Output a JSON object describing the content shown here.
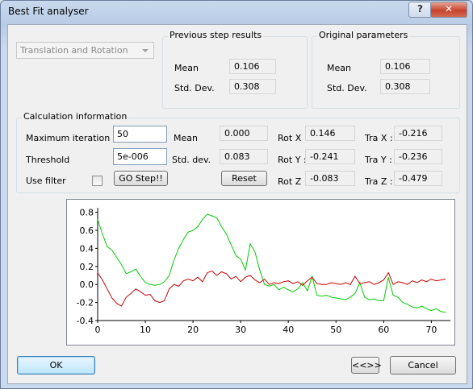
{
  "window": {
    "title": "Best Fit analyser",
    "help_label": "?",
    "close_label": "✕"
  },
  "mode": {
    "selected": "Translation and Rotation"
  },
  "previous": {
    "label": "Previous step results",
    "mean_label": "Mean",
    "mean": "0.106",
    "std_label": "Std. Dev.",
    "std": "0.308"
  },
  "original": {
    "label": "Original parameters",
    "mean_label": "Mean",
    "mean": "0.106",
    "std_label": "Std. Dev.",
    "std": "0.308"
  },
  "calc": {
    "label": "Calculation information",
    "max_iter_label": "Maximum iteration",
    "max_iter": "50",
    "threshold_label": "Threshold",
    "threshold": "5e-006",
    "use_filter_label": "Use filter",
    "go_label": "GO Step!!",
    "reset_label": "Reset",
    "mean_label": "Mean",
    "mean": "0.000",
    "std_label": "Std. dev.",
    "std": "0.083",
    "rotx_label": "Rot X :",
    "rotx": "0.146",
    "roty_label": "Rot Y :",
    "roty": "-0.241",
    "rotz_label": "Rot Z :",
    "rotz": "-0.083",
    "trax_label": "Tra X :",
    "trax": "-0.216",
    "tray_label": "Tra Y :",
    "tray": "-0.236",
    "traz_label": "Tra Z :",
    "traz": "-0.479"
  },
  "buttons": {
    "ok": "OK",
    "swap": "<<>>",
    "cancel": "Cancel"
  },
  "colors": {
    "green_series": "#00cc00",
    "red_series": "#cc0000"
  },
  "chart_data": {
    "type": "line",
    "xlim": [
      0,
      74
    ],
    "ylim": [
      -0.4,
      0.85
    ],
    "xticks": [
      "0",
      "10",
      "20",
      "30",
      "40",
      "50",
      "60",
      "70"
    ],
    "yticks": [
      "0.8",
      "0.6",
      "0.4",
      "0.2",
      "0.0",
      "-0.2",
      "-0.4"
    ],
    "grid": false,
    "series": [
      {
        "color": "#00cc00",
        "x": [
          0,
          1,
          2,
          3,
          4,
          5,
          6,
          7,
          8,
          9,
          10,
          11,
          12,
          13,
          14,
          15,
          16,
          17,
          18,
          19,
          20,
          21,
          22,
          23,
          24,
          25,
          26,
          27,
          28,
          29,
          30,
          31,
          32,
          33,
          34,
          35,
          36,
          37,
          38,
          39,
          40,
          41,
          42,
          43,
          44,
          45,
          46,
          47,
          48,
          49,
          50,
          51,
          52,
          53,
          54,
          55,
          56,
          57,
          58,
          59,
          60,
          61,
          62,
          63,
          64,
          65,
          66,
          67,
          68,
          69,
          70,
          71,
          72,
          73
        ],
        "y": [
          0.72,
          0.56,
          0.42,
          0.38,
          0.3,
          0.22,
          0.12,
          0.14,
          0.17,
          0.09,
          0.02,
          0.0,
          -0.01,
          0.0,
          0.03,
          0.1,
          0.27,
          0.4,
          0.5,
          0.58,
          0.6,
          0.64,
          0.72,
          0.78,
          0.76,
          0.74,
          0.64,
          0.56,
          0.44,
          0.32,
          0.28,
          0.16,
          0.45,
          0.36,
          0.16,
          0.0,
          -0.02,
          0.0,
          -0.06,
          -0.03,
          -0.06,
          -0.08,
          -0.05,
          0.02,
          -0.07,
          0.09,
          -0.12,
          -0.13,
          -0.12,
          -0.14,
          -0.15,
          -0.16,
          -0.17,
          -0.14,
          -0.1,
          0.02,
          -0.14,
          -0.17,
          -0.16,
          -0.18,
          -0.18,
          0.08,
          -0.12,
          -0.14,
          -0.2,
          -0.22,
          -0.25,
          -0.26,
          -0.24,
          -0.27,
          -0.29,
          -0.27,
          -0.3,
          -0.31
        ]
      },
      {
        "color": "#cc0000",
        "x": [
          0,
          1,
          2,
          3,
          4,
          5,
          6,
          7,
          8,
          9,
          10,
          11,
          12,
          13,
          14,
          15,
          16,
          17,
          18,
          19,
          20,
          21,
          22,
          23,
          24,
          25,
          26,
          27,
          28,
          29,
          30,
          31,
          32,
          33,
          34,
          35,
          36,
          37,
          38,
          39,
          40,
          41,
          42,
          43,
          44,
          45,
          46,
          47,
          48,
          49,
          50,
          51,
          52,
          53,
          54,
          55,
          56,
          57,
          58,
          59,
          60,
          61,
          62,
          63,
          64,
          65,
          66,
          67,
          68,
          69,
          70,
          71,
          72,
          73
        ],
        "y": [
          0.13,
          0.05,
          -0.05,
          -0.15,
          -0.21,
          -0.24,
          -0.14,
          -0.1,
          -0.05,
          -0.08,
          -0.12,
          -0.11,
          -0.18,
          -0.2,
          -0.18,
          -0.05,
          0.0,
          -0.02,
          0.04,
          0.06,
          0.04,
          0.08,
          0.03,
          0.13,
          0.15,
          0.1,
          0.14,
          0.12,
          0.06,
          0.09,
          0.03,
          0.08,
          0.1,
          0.05,
          0.02,
          0.06,
          0.0,
          0.02,
          0.01,
          0.03,
          0.04,
          0.01,
          0.03,
          -0.01,
          0.04,
          0.08,
          0.01,
          0.0,
          0.0,
          0.02,
          0.01,
          0.0,
          0.02,
          0.0,
          0.09,
          0.01,
          0.02,
          0.03,
          0.0,
          0.02,
          0.05,
          0.13,
          0.0,
          0.03,
          0.02,
          0.0,
          0.04,
          0.02,
          0.05,
          0.03,
          0.06,
          0.04,
          0.05,
          0.06
        ]
      }
    ]
  }
}
